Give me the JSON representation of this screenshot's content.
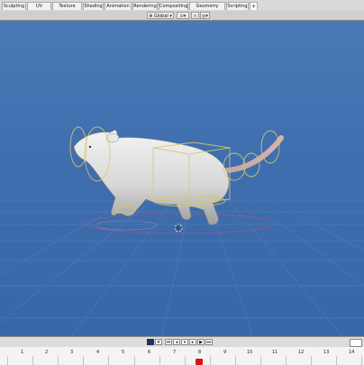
{
  "workspace_tabs": [
    "Sculpting",
    "UV Editing",
    "Texture Paint",
    "Shading",
    "Animation",
    "Rendering",
    "Compositing",
    "Geometry Nodes",
    "Scripting",
    "+"
  ],
  "viewport_header": {
    "orientation_label": "Global",
    "orientation_icon": "globe-icon",
    "pivot_icon": "pivot-icon",
    "snap_icon": "magnet-icon",
    "proportional_icon": "proportional-edit-icon"
  },
  "timeline": {
    "frame_labels": [
      "1",
      "2",
      "3",
      "4",
      "5",
      "6",
      "7",
      "8",
      "9",
      "10",
      "11",
      "12",
      "13",
      "14"
    ],
    "current_frame_indicator_color": "#e01010",
    "controls": [
      "jump-start-icon",
      "step-back-icon",
      "play-reverse-icon",
      "pause-icon",
      "play-icon",
      "step-forward-icon",
      "jump-end-icon"
    ]
  },
  "colors": {
    "viewport_bg": "#3d6aa8",
    "rig_control": "#d8c86a",
    "rig_control_pink": "#c44a8a"
  }
}
